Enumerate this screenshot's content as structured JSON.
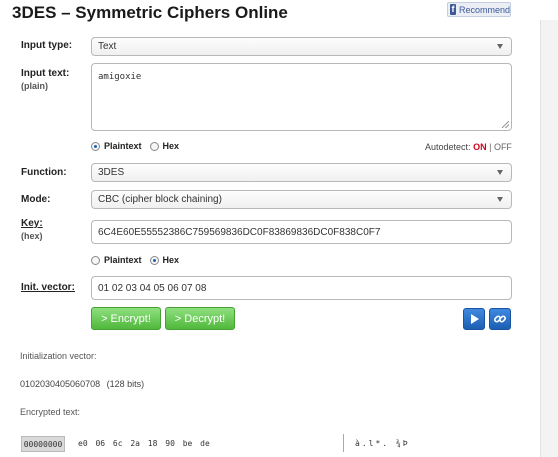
{
  "page": {
    "title": "3DES – Symmetric Ciphers Online",
    "recommend_label": "Recommend"
  },
  "form": {
    "input_type": {
      "label": "Input type:",
      "value": "Text"
    },
    "input_text": {
      "label": "Input text:",
      "sublabel": "(plain)",
      "value": "amigoxie"
    },
    "input_format": {
      "plaintext_label": "Plaintext",
      "hex_label": "Hex",
      "selected": "Plaintext"
    },
    "autodetect": {
      "label": "Autodetect:",
      "on": "ON",
      "separator": "|",
      "off": "OFF"
    },
    "function": {
      "label": "Function:",
      "value": "3DES"
    },
    "mode": {
      "label": "Mode:",
      "value": "CBC (cipher block chaining)"
    },
    "key": {
      "label": "Key:",
      "sublabel": "(hex)",
      "value": "6C4E60E55552386C759569836DC0F83869836DC0F838C0F7"
    },
    "key_format": {
      "plaintext_label": "Plaintext",
      "hex_label": "Hex",
      "selected": "Hex"
    },
    "iv": {
      "label": "Init. vector:",
      "value": "01 02 03 04 05 06 07 08"
    },
    "buttons": {
      "encrypt": "> Encrypt!",
      "decrypt": "> Decrypt!"
    }
  },
  "output": {
    "iv_label": "Initialization vector:",
    "iv_value": "0102030405060708",
    "iv_bits": "(128 bits)",
    "encrypted_label": "Encrypted text:",
    "hex_offset": "00000000",
    "hex_bytes": "e0 06 6c 2a 18 90 be de",
    "hex_ascii": "à.l*. ¾Þ"
  },
  "colors": {
    "encrypt_button": "#5cc349",
    "icon_button": "#1c5fb3",
    "on_color": "#d0021b"
  },
  "icons": {
    "play": "play-icon",
    "link": "link-icon",
    "facebook": "facebook-icon"
  }
}
